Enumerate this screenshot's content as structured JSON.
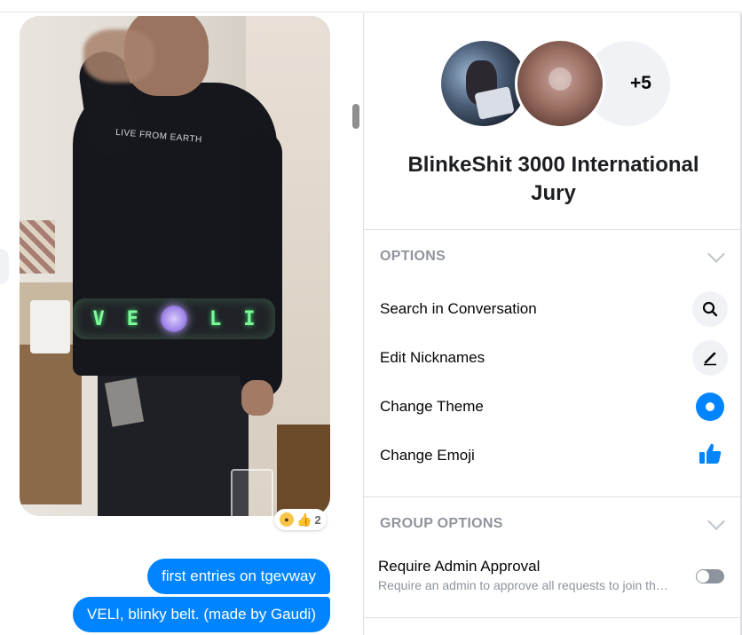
{
  "chat": {
    "photo_shirt_text": "LIVE FROM EARTH",
    "belt_letters": [
      "V",
      "E",
      "L",
      "I"
    ],
    "reaction": {
      "emojis": [
        "wow",
        "like"
      ],
      "count": "2"
    },
    "messages": [
      {
        "text": "first entries on tgevway"
      },
      {
        "text": "VELI, blinky belt. (made by Gaudi)"
      }
    ]
  },
  "info": {
    "avatars_more": "+5",
    "title": "BlinkeShit 3000 International Jury",
    "options": {
      "header": "OPTIONS",
      "items": [
        {
          "label": "Search in Conversation",
          "icon": "search-icon"
        },
        {
          "label": "Edit Nicknames",
          "icon": "pencil-icon"
        },
        {
          "label": "Change Theme",
          "icon": "theme-icon"
        },
        {
          "label": "Change Emoji",
          "icon": "thumbs-up-icon"
        }
      ]
    },
    "group_options": {
      "header": "GROUP OPTIONS",
      "require_admin_label": "Require Admin Approval",
      "require_admin_desc": "Require an admin to approve all requests to join th…",
      "require_admin_enabled": false
    }
  },
  "colors": {
    "accent": "#0084ff",
    "muted": "#90949c"
  }
}
